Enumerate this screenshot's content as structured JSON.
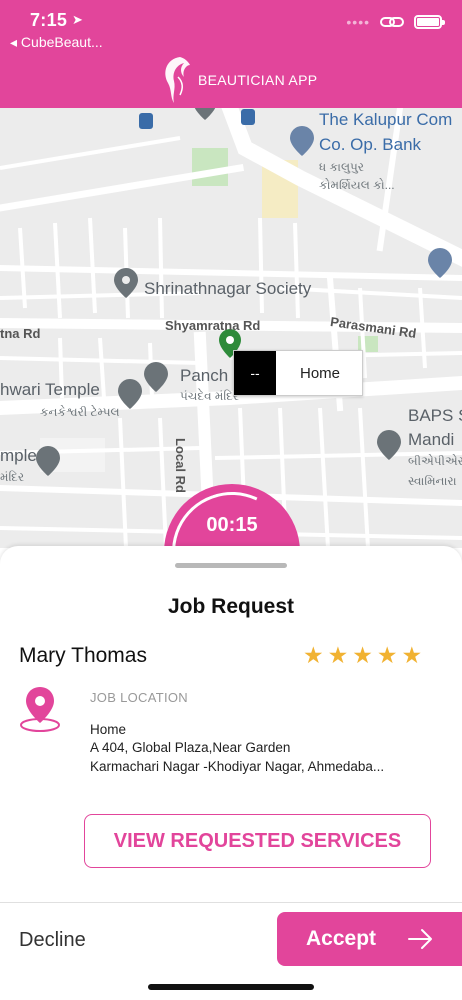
{
  "status_bar": {
    "time": "7:15",
    "location_icon": "location-arrow-icon",
    "back_app": "◂ CubeBeaut..."
  },
  "header": {
    "title": "BEAUTICIAN APP",
    "logo_icon": "woman-profile-logo-icon",
    "color": "#e2459b"
  },
  "map": {
    "pois": {
      "kalupur_bank_line1": "The Kalupur Com",
      "kalupur_bank_line2": "Co. Op. Bank",
      "kalupur_gujarati_line1": "ધ કાલુપુર",
      "kalupur_gujarati_line2": "કોમર્શિયલ કો...",
      "shrinathnagar": "Shrinathnagar Society",
      "panch": "Panch",
      "panch_gujarati": "પંચદેવ મંદિર",
      "temple": "hwari Temple",
      "temple_gujarati": "કનકેશ્વરી ટેમ્પલ",
      "mple": "mple",
      "mple_gujarati": "મંદિર",
      "baps_line1": "BAPS S",
      "baps_line2": "Mandi",
      "baps_gujarati_line1": "બીએપીએસ",
      "baps_gujarati_line2": "સ્વામિનારા"
    },
    "roads": {
      "shyamratna": "Shyamratna Rd",
      "parasmani": "Parasmani Rd",
      "tna": "tna Rd",
      "local": "Local Rd"
    },
    "callout": {
      "placeholder": "--",
      "label": "Home"
    }
  },
  "timer": {
    "value": "00:15"
  },
  "job": {
    "title": "Job Request",
    "customer_name": "Mary Thomas",
    "rating": 5,
    "rating_max": 5,
    "location_label": "JOB LOCATION",
    "address_line1": "Home",
    "address_line2": "A 404, Global Plaza,Near Garden",
    "address_line3": "Karmachari Nagar -Khodiyar Nagar, Ahmedaba...",
    "view_services_label": "VIEW REQUESTED SERVICES"
  },
  "actions": {
    "decline_label": "Decline",
    "accept_label": "Accept"
  }
}
